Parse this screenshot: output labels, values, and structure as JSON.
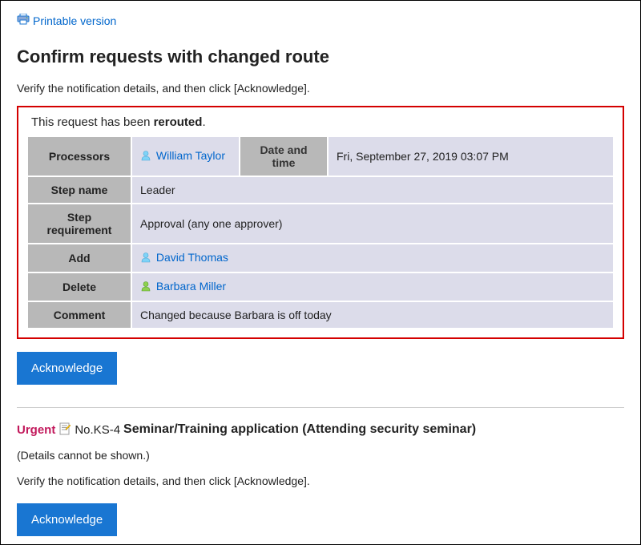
{
  "header": {
    "printable_label": "Printable version",
    "page_title": "Confirm requests with changed route",
    "instruction": "Verify the notification details, and then click [Acknowledge]."
  },
  "reroute": {
    "message_prefix": "This request has been ",
    "message_bold": "rerouted",
    "message_suffix": ".",
    "labels": {
      "processors": "Processors",
      "datetime": "Date and time",
      "step_name": "Step name",
      "step_requirement": "Step requirement",
      "add": "Add",
      "delete": "Delete",
      "comment": "Comment"
    },
    "values": {
      "processor_name": "William Taylor",
      "datetime": "Fri, September 27, 2019 03:07 PM",
      "step_name": "Leader",
      "step_requirement": "Approval (any one approver)",
      "add_name": "David Thomas",
      "delete_name": "Barbara Miller",
      "comment": "Changed because Barbara is off today"
    }
  },
  "buttons": {
    "acknowledge": "Acknowledge"
  },
  "second_request": {
    "urgent_label": "Urgent",
    "doc_no": "No.KS-4",
    "doc_title": "Seminar/Training application (Attending security seminar)",
    "details_hidden": "(Details cannot be shown.)",
    "instruction": "Verify the notification details, and then click [Acknowledge]."
  }
}
